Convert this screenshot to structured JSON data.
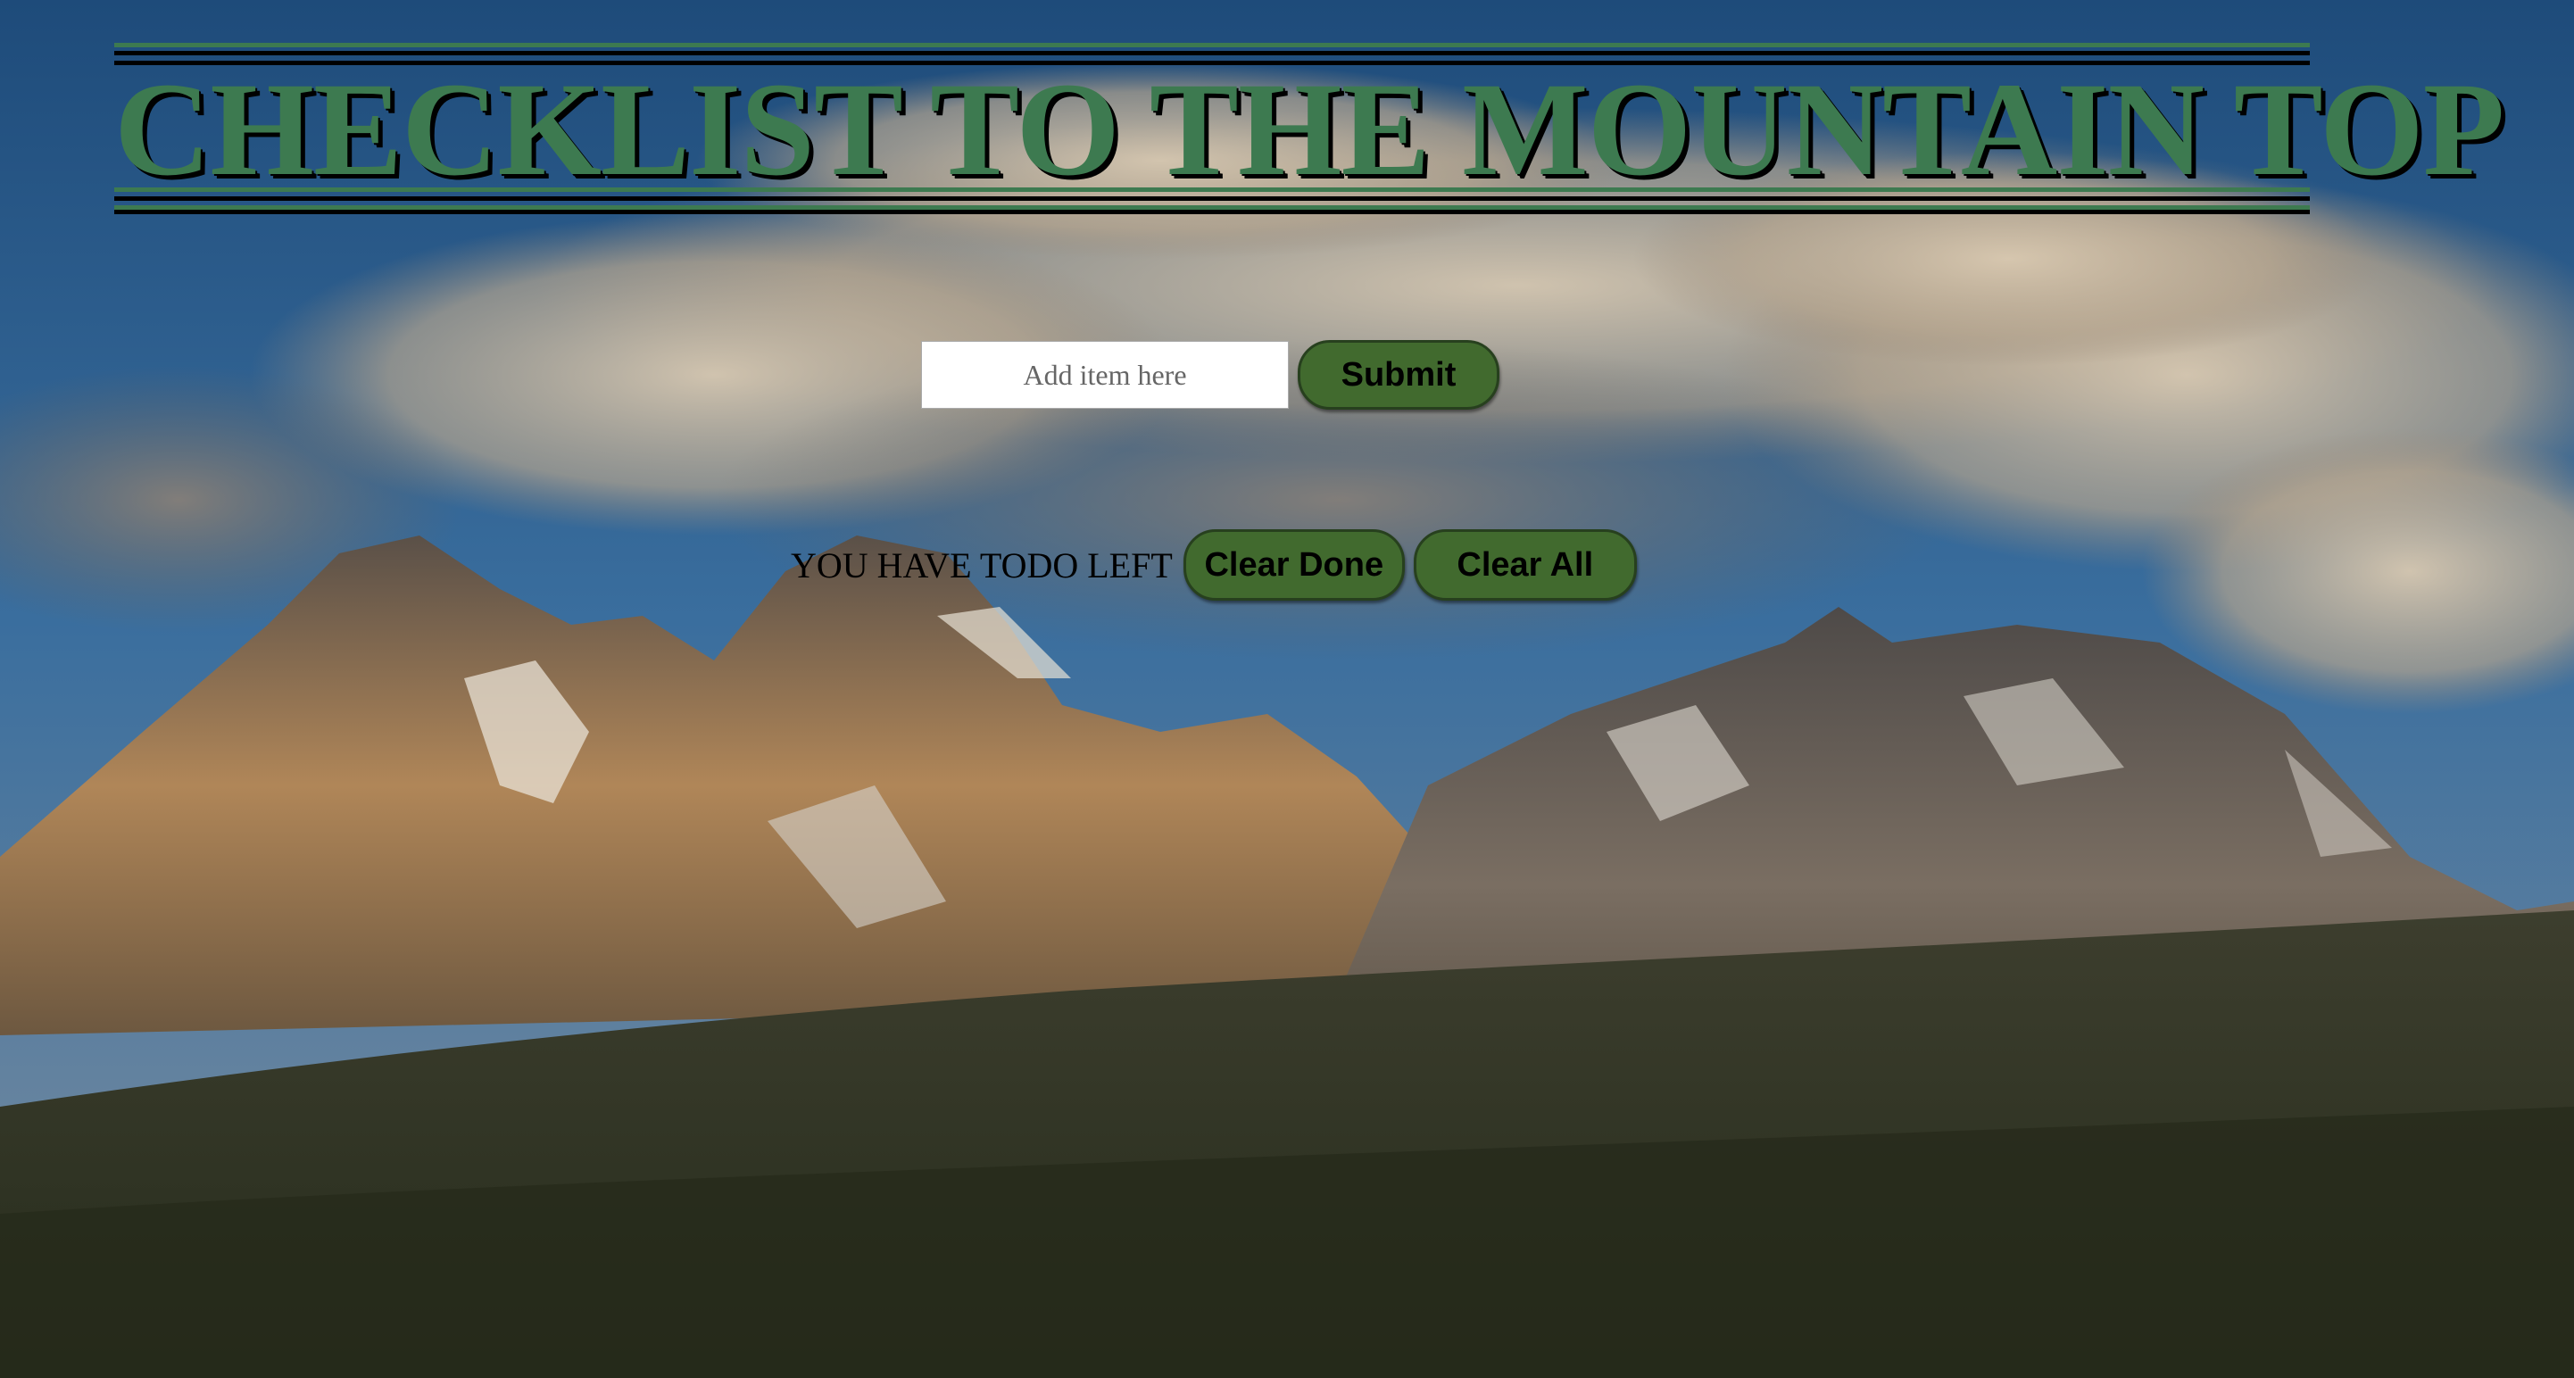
{
  "header": {
    "title": "CHECKLIST TO THE MOUNTAIN TOP"
  },
  "form": {
    "input_placeholder": "Add item here",
    "input_value": "",
    "submit_label": "Submit"
  },
  "status": {
    "todo_text": "YOU HAVE TODO LEFT",
    "clear_done_label": "Clear Done",
    "clear_all_label": "Clear All"
  },
  "background": {
    "icon": "mountain-landscape-photo"
  },
  "colors": {
    "accent_green": "#3d7a50",
    "button_green": "#416a2e"
  }
}
